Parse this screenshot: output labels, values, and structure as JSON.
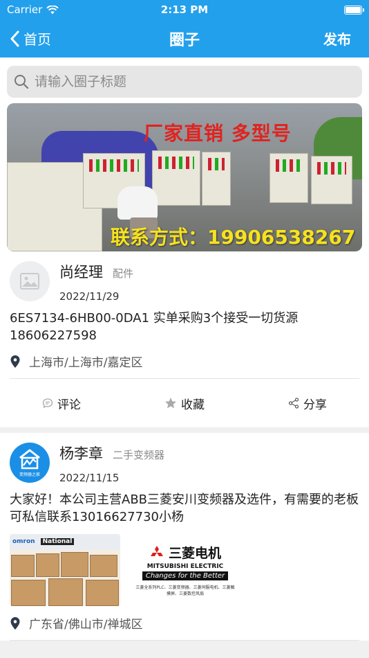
{
  "status_bar": {
    "carrier": "Carrier",
    "time": "2:13 PM",
    "battery_level": 1.0
  },
  "nav": {
    "back_label": "首页",
    "title": "圈子",
    "action_label": "发布"
  },
  "search": {
    "placeholder": "请输入圈子标题",
    "value": ""
  },
  "banner": {
    "headline": "厂家直销 多型号",
    "contact": "联系方式：19906538267"
  },
  "posts": [
    {
      "author": "尚经理",
      "category": "配件",
      "date": "2022/11/29",
      "content": "6ES7134-6HB00-0DA1 实单采购3个接受一切货源18606227598",
      "location": "上海市/上海市/嘉定区",
      "actions": {
        "comment": "评论",
        "favorite": "收藏",
        "share": "分享"
      }
    },
    {
      "author": "杨李章",
      "category": "二手变频器",
      "date": "2022/11/15",
      "content": "大家好！本公司主营ABB三菱安川变频器及选件，有需要的老板可私信联系13016627730小杨",
      "location": "广东省/佛山市/禅城区",
      "avatar_text": "变频器之家",
      "images": {
        "left_brands": [
          "omron",
          "National"
        ],
        "mitsubishi_cn": "三菱电机",
        "mitsubishi_en": "MITSUBISHI ELECTRIC",
        "mitsubishi_slogan": "Changes for the Better",
        "mitsubishi_desc": "三菱全系列PLC、三菱变频器、三菱伺服电机、三菱触摸屏、三菱数控风扇"
      }
    }
  ],
  "colors": {
    "accent": "#23a0ec",
    "banner_headline": "#e0231f",
    "banner_contact": "#f7e21c"
  },
  "icons": [
    "wifi-icon",
    "battery-icon",
    "chevron-left-icon",
    "search-icon",
    "image-placeholder-icon",
    "location-pin-icon",
    "comment-icon",
    "star-icon",
    "share-icon",
    "mitsubishi-logo-icon"
  ]
}
